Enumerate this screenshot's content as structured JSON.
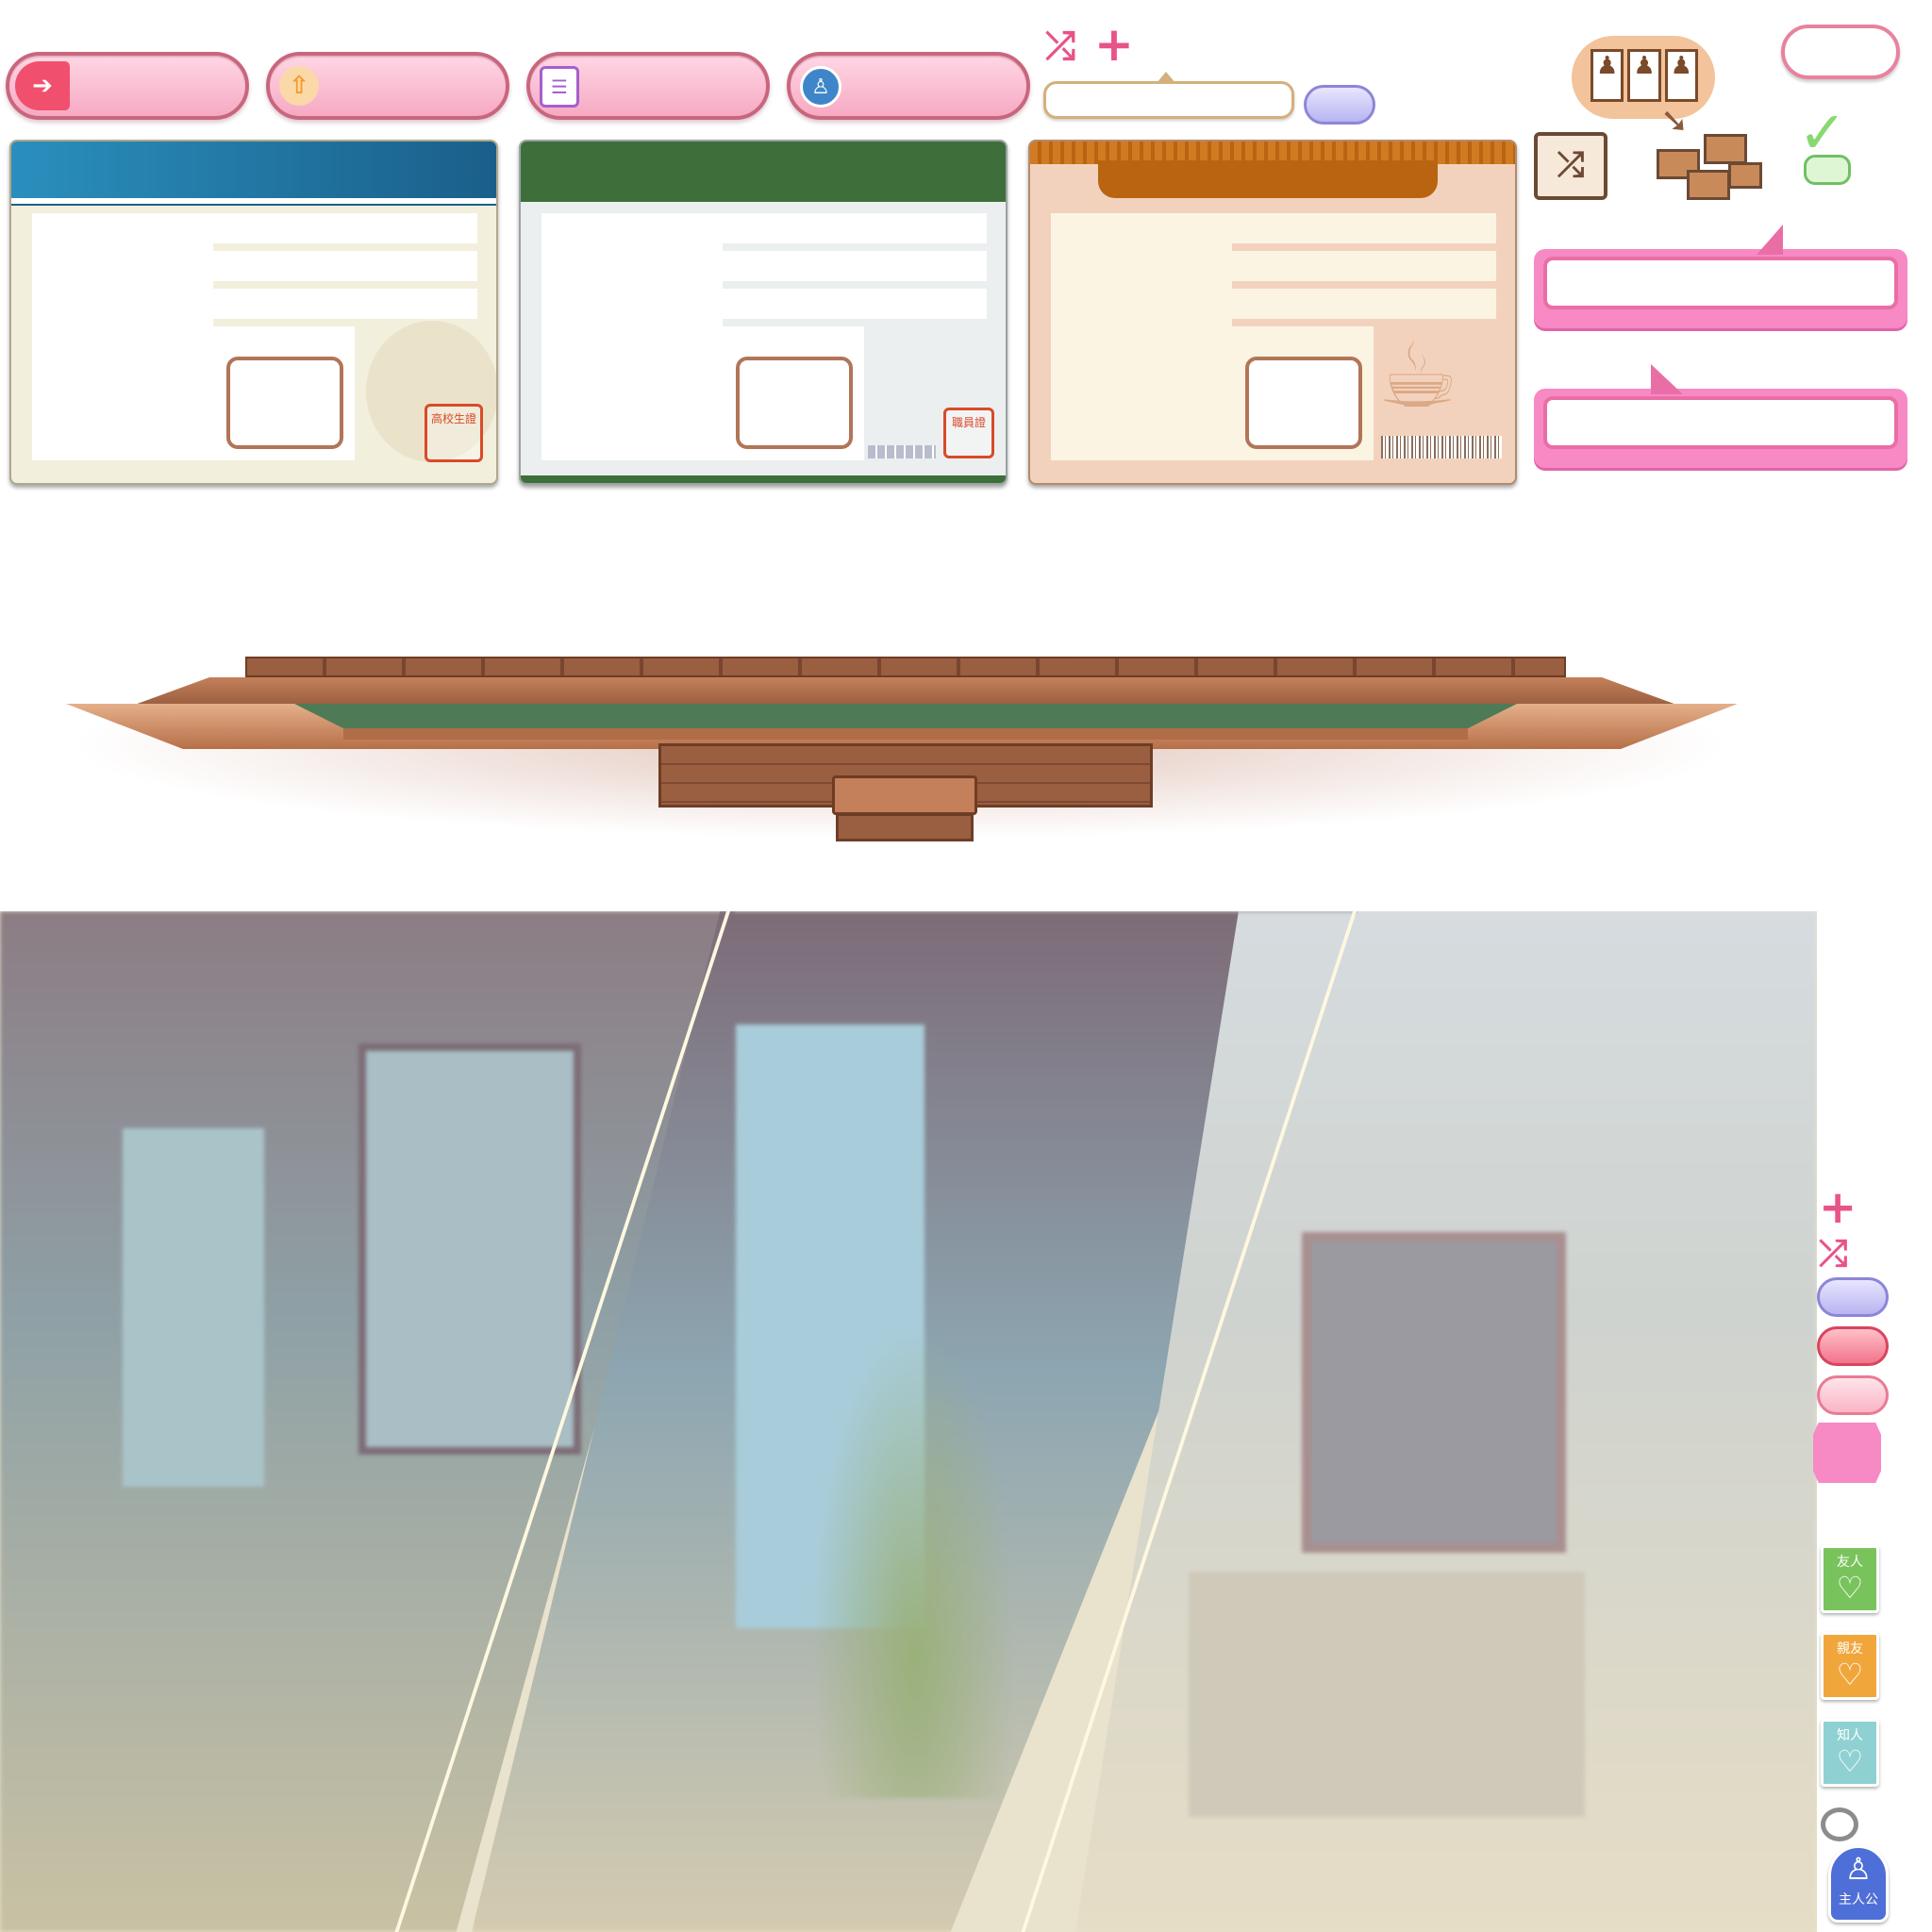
{
  "top_buttons": [
    {
      "name": "login-button",
      "icon": "login-icon",
      "color": "#f0506e"
    },
    {
      "name": "upload-button",
      "icon": "upload-icon",
      "color": "#f39a28"
    },
    {
      "name": "profile-book-button",
      "icon": "contact-book-icon",
      "color": "#a45fd0"
    },
    {
      "name": "character-button",
      "icon": "person-icon",
      "color": "#3e86c9"
    }
  ],
  "icons": {
    "shuffle": "⤮",
    "plus": "+",
    "check": "✓",
    "heart": "♡"
  },
  "cards": [
    {
      "name": "student-id-card",
      "theme": "blue",
      "stamp": "高校生證"
    },
    {
      "name": "employee-id-card",
      "theme": "green",
      "stamp": "職員證"
    },
    {
      "name": "cafe-member-card",
      "theme": "orange"
    }
  ],
  "relations": {
    "friend": "友人",
    "best_friend": "親友",
    "acquaintance": "知人",
    "protagonist": "主人公"
  },
  "colors": {
    "pink": "#f789c4",
    "lavender": "#b8b4f0",
    "coral": "#f2748c",
    "light_pink": "#f9b5c6",
    "friend_green": "#79c35c",
    "best_friend_orange": "#f1a63c",
    "acquaintance_teal": "#8fd1d2",
    "protagonist_blue": "#4f6fd8"
  }
}
